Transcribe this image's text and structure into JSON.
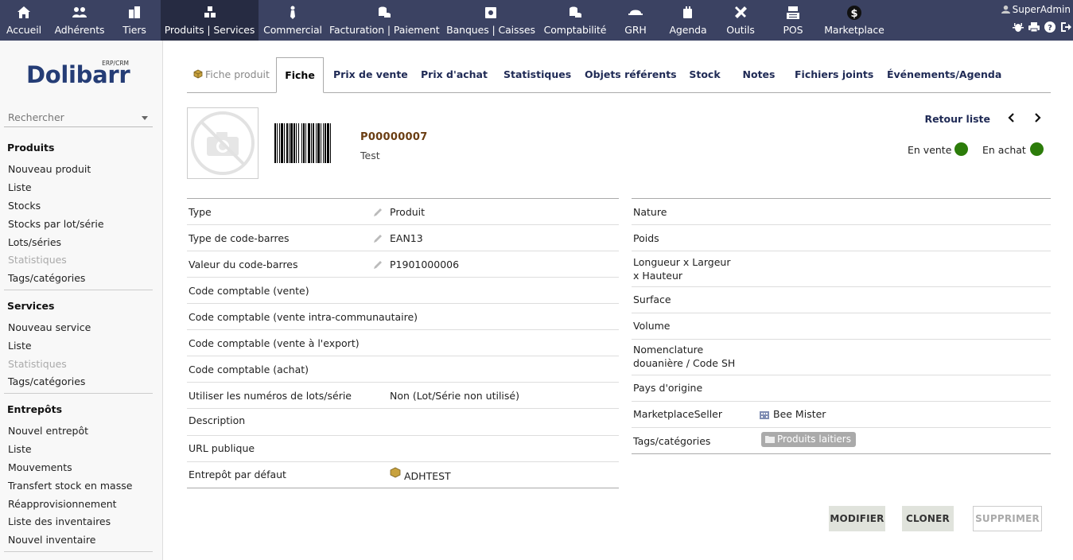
{
  "topmenu": [
    {
      "label": "Accueil",
      "icon": "home-icon"
    },
    {
      "label": "Adhérents",
      "icon": "members-icon"
    },
    {
      "label": "Tiers",
      "icon": "building-icon"
    },
    {
      "label": "Produits | Services",
      "icon": "cubes-icon"
    },
    {
      "label": "Commercial",
      "icon": "tie-icon"
    },
    {
      "label": "Facturation | Paiement",
      "icon": "coins-icon"
    },
    {
      "label": "Banques | Caisses",
      "icon": "safe-icon"
    },
    {
      "label": "Comptabilité",
      "icon": "coins-icon"
    },
    {
      "label": "GRH",
      "icon": "hat-icon"
    },
    {
      "label": "Agenda",
      "icon": "agenda-icon"
    },
    {
      "label": "Outils",
      "icon": "tools-icon"
    },
    {
      "label": "POS",
      "icon": "cash-register-icon"
    },
    {
      "label": "Marketplace",
      "icon": "dollar-circle-icon"
    }
  ],
  "user": {
    "name": "SuperAdmin"
  },
  "logo": {
    "text": "Dolibarr",
    "sub": "ERP/CRM"
  },
  "search": {
    "placeholder": "Rechercher"
  },
  "sidebar": {
    "produits": {
      "title": "Produits",
      "items": [
        "Nouveau produit",
        "Liste",
        "Stocks",
        "Stocks par lot/série",
        "Lots/séries",
        "Statistiques",
        "Tags/catégories"
      ]
    },
    "services": {
      "title": "Services",
      "items": [
        "Nouveau service",
        "Liste",
        "Statistiques",
        "Tags/catégories"
      ]
    },
    "entrepots": {
      "title": "Entrepôts",
      "items": [
        "Nouvel entrepôt",
        "Liste",
        "Mouvements",
        "Transfert stock en masse",
        "Réapprovisionnement",
        "Liste des inventaires",
        "Nouvel inventaire"
      ]
    }
  },
  "tabs": {
    "head": "Fiche produit",
    "items": [
      "Fiche",
      "Prix de vente",
      "Prix d'achat",
      "Statistiques",
      "Objets référents",
      "Stock",
      "Notes",
      "Fichiers joints",
      "Événements/Agenda"
    ]
  },
  "product": {
    "ref": "P00000007",
    "label": "Test",
    "back_list": "Retour liste",
    "on_sale": "En vente",
    "on_purchase": "En achat",
    "status_color": "#2c7c0a"
  },
  "left_fields": [
    {
      "label": "Type",
      "value": "Produit"
    },
    {
      "label": "Type de code-barres",
      "value": "EAN13"
    },
    {
      "label": "Valeur du code-barres",
      "value": "P1901000006"
    },
    {
      "label": "Code comptable (vente)",
      "value": ""
    },
    {
      "label": "Code comptable (vente intra-communautaire)",
      "value": ""
    },
    {
      "label": "Code comptable (vente à l'export)",
      "value": ""
    },
    {
      "label": "Code comptable (achat)",
      "value": ""
    },
    {
      "label": "Utiliser les numéros de lots/série",
      "value": "Non (Lot/Série non utilisé)"
    },
    {
      "label": "Description",
      "value": ""
    },
    {
      "label": "URL publique",
      "value": ""
    },
    {
      "label": "Entrepôt par défaut",
      "value": "ADHTEST"
    }
  ],
  "right_fields": [
    {
      "label": "Nature",
      "value": ""
    },
    {
      "label": "Poids",
      "value": ""
    },
    {
      "label": "Longueur x Largeur x Hauteur",
      "value": ""
    },
    {
      "label": "Surface",
      "value": ""
    },
    {
      "label": "Volume",
      "value": ""
    },
    {
      "label": "Nomenclature douanière / Code SH",
      "value": ""
    },
    {
      "label": "Pays d'origine",
      "value": ""
    },
    {
      "label": "MarketplaceSeller",
      "value": "Bee Mister"
    },
    {
      "label": "Tags/catégories",
      "value": "Produits laitiers"
    }
  ],
  "buttons": {
    "modify": "MODIFIER",
    "clone": "CLONER",
    "delete": "SUPPRIMER"
  },
  "colors": {
    "topbar": "#3b4262",
    "link": "#1f2a55",
    "ref": "#6a3d12"
  }
}
